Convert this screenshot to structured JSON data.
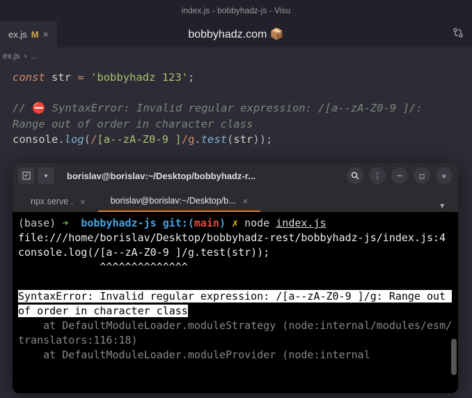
{
  "window": {
    "title": "index.js - bobbyhadz-js - Visu"
  },
  "tab": {
    "filename": "ex.js",
    "badge": "M",
    "close": "×"
  },
  "site_label": "bobbyhadz.com 📦",
  "breadcrumb": {
    "file": "ex.js",
    "sep": "›",
    "rest": "..."
  },
  "code": {
    "l1_const": "const",
    "l1_var": "str",
    "l1_op": "=",
    "l1_str": "'bobbyhadz 123'",
    "l1_end": ";",
    "l2_comment_prefix": "//",
    "l2_icon": "⛔",
    "l2_text1": "SyntaxError: Invalid regular expression: /[a--zA-Z0-9 ]/:",
    "l2_text2": "Range out of order in character class",
    "l3_obj": "console",
    "l3_dot1": ".",
    "l3_method": "log",
    "l3_open": "(",
    "l3_regex_delim1": "/",
    "l3_regex_body": "[a--zA-Z0-9 ]",
    "l3_regex_delim2": "/",
    "l3_regex_flag": "g",
    "l3_dot2": ".",
    "l3_test": "test",
    "l3_open2": "(",
    "l3_arg": "str",
    "l3_close": "));"
  },
  "terminal": {
    "hostpath": "borislav@borislav:~/Desktop/bobbyhadz-r...",
    "tabs": {
      "t1": "npx serve .",
      "t2": "borislav@borislav:~/Desktop/b..."
    },
    "prompt": {
      "base": "(base)",
      "arrow": "➜",
      "dir": "bobbyhadz-js",
      "git": "git:(",
      "branch": "main",
      "git_close": ")",
      "thunder": "✗",
      "cmd_node": "node",
      "cmd_file": "index.js"
    },
    "out": {
      "l1": "file:///home/borislav/Desktop/bobbyhadz-rest/bobbyhadz-js/index.js:4",
      "l2": "console.log(/[a--zA-Z0-9 ]/g.test(str));",
      "l3": "             ^^^^^^^^^^^^^^",
      "err1": "SyntaxError: Invalid regular expression: /[a--zA-Z0-9 ]/g: Range out of order in character class",
      "stack1": "    at DefaultModuleLoader.moduleStrategy (node:internal/modules/esm/translators:116:18)",
      "stack2": "    at DefaultModuleLoader.moduleProvider (node:internal"
    }
  }
}
